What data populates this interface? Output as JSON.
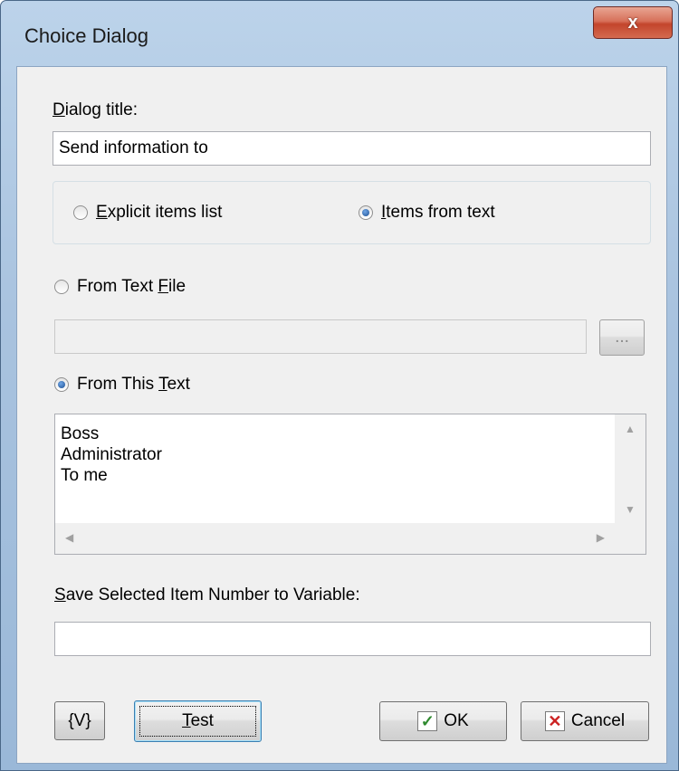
{
  "window": {
    "title": "Choice Dialog",
    "close_glyph": "x"
  },
  "dialog_title": {
    "label_hotkey": "D",
    "label_rest": "ialog title:",
    "value": "Send information to"
  },
  "mode": {
    "explicit": {
      "hotkey": "E",
      "rest": "xplicit items list",
      "checked": false
    },
    "from_text": {
      "hotkey": "I",
      "rest": "tems from text",
      "checked": true
    }
  },
  "source": {
    "from_file": {
      "pre": "From Text ",
      "hotkey": "F",
      "rest": "ile",
      "checked": false,
      "value": ""
    },
    "browse_label": "...",
    "from_this_text": {
      "pre": "From This ",
      "hotkey": "T",
      "rest": "ext",
      "checked": true
    },
    "text_lines": [
      "Boss",
      "Administrator",
      "To me"
    ]
  },
  "save_var": {
    "hotkey": "S",
    "rest": "ave Selected Item Number to Variable:",
    "value": ""
  },
  "buttons": {
    "variables": "{V}",
    "test_hotkey": "T",
    "test_rest": "est",
    "ok": "OK",
    "cancel": "Cancel"
  },
  "icons": {
    "ok": "checkmark-icon",
    "cancel": "x-icon"
  },
  "colors": {
    "title_bar": "#a9c3df",
    "close_button": "#c3452c",
    "client": "#f0f0f0"
  }
}
